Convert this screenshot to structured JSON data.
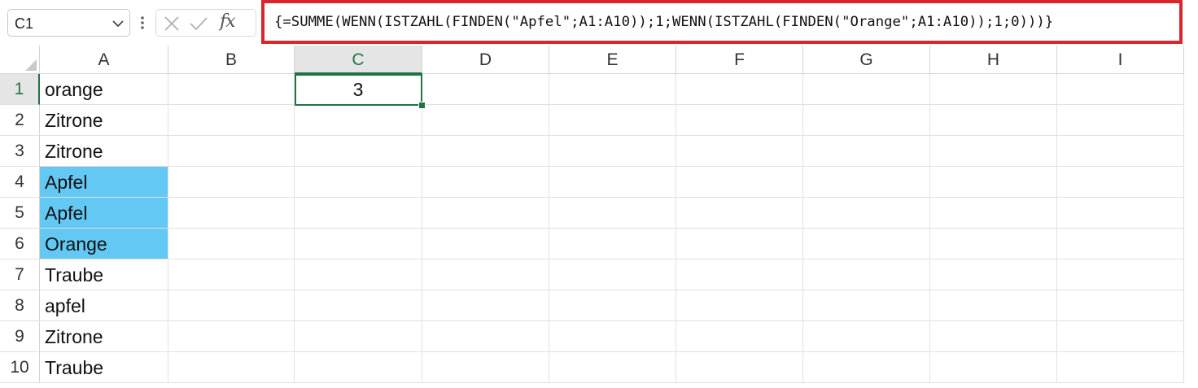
{
  "name_box": {
    "value": "C1"
  },
  "formula_bar": {
    "formula": "{=SUMME(WENN(ISTZAHL(FINDEN(\"Apfel\";A1:A10));1;WENN(ISTZAHL(FINDEN(\"Orange\";A1:A10));1;0)))}",
    "fx_label": "fx",
    "highlight_color": "#d9262c"
  },
  "columns": [
    "A",
    "B",
    "C",
    "D",
    "E",
    "F",
    "G",
    "H",
    "I"
  ],
  "selected_column": "C",
  "rows": [
    "1",
    "2",
    "3",
    "4",
    "5",
    "6",
    "7",
    "8",
    "9",
    "10"
  ],
  "selected_row": "1",
  "column_a": [
    "orange",
    "Zitrone",
    "Zitrone",
    "Apfel",
    "Apfel",
    "Orange",
    "Traube",
    "apfel",
    "Zitrone",
    "Traube"
  ],
  "highlighted_rows": [
    4,
    5,
    6
  ],
  "highlight_fill_color": "#63c9f4",
  "cell_c1": "3",
  "accent_color": "#217346"
}
